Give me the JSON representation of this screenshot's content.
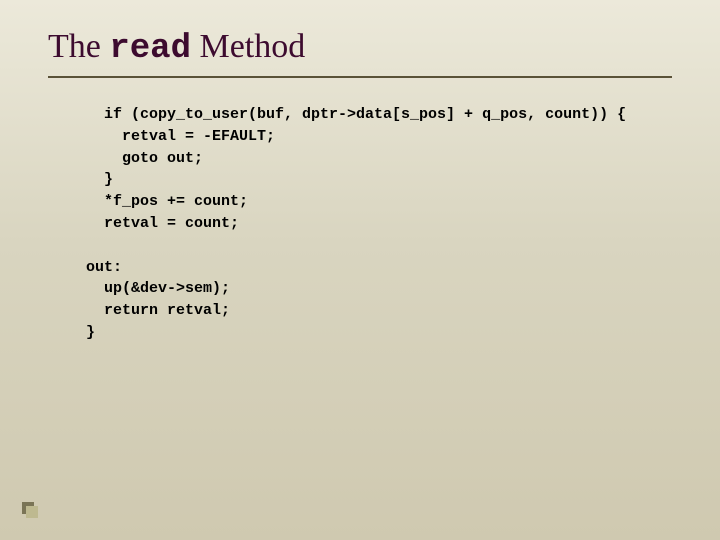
{
  "title_prefix": "The ",
  "title_mono": "read",
  "title_suffix": " Method",
  "code_block_1": "  if (copy_to_user(buf, dptr->data[s_pos] + q_pos, count)) {\n    retval = -EFAULT;\n    goto out;\n  }\n  *f_pos += count;\n  retval = count;",
  "code_block_2": "out:\n  up(&dev->sem);\n  return retval;\n}"
}
